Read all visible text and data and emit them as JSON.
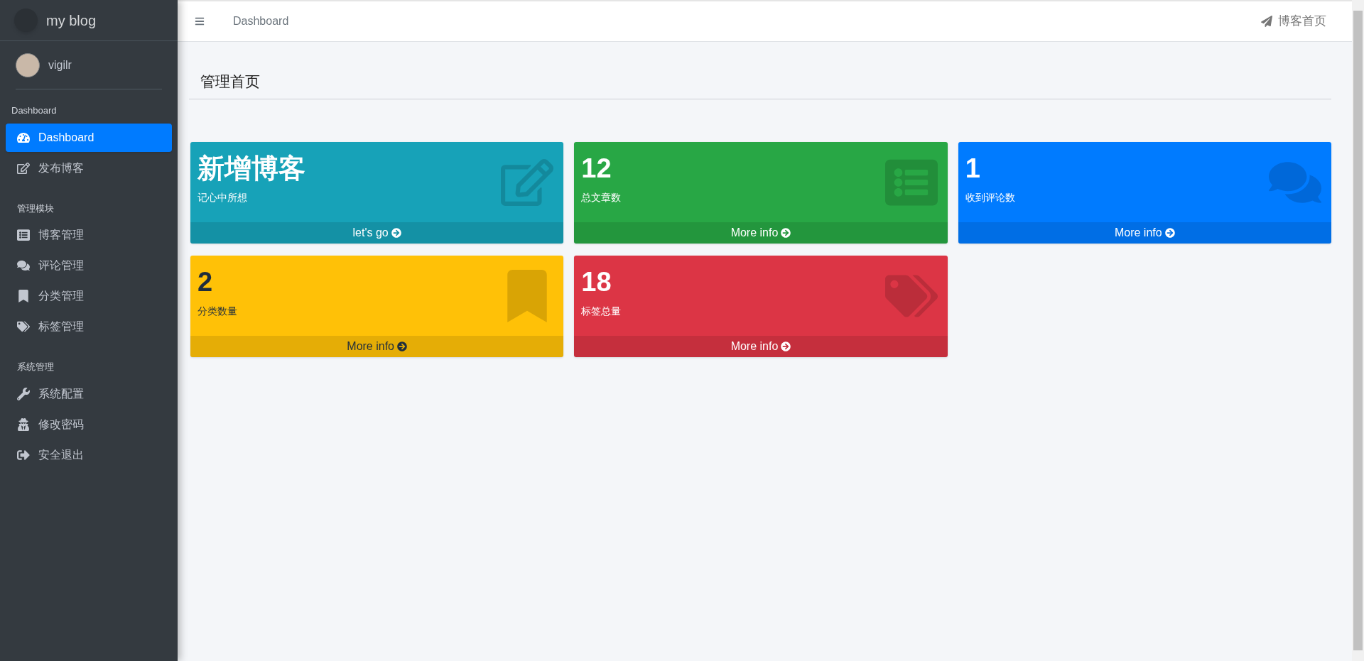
{
  "brand": {
    "title": "my blog"
  },
  "user": {
    "name": "vigilr"
  },
  "sidebar": {
    "sections": [
      {
        "heading": "Dashboard",
        "items": [
          {
            "kind": "dashboard",
            "label": "Dashboard",
            "selected": true
          },
          {
            "kind": "edit",
            "label": "发布博客",
            "selected": false
          }
        ]
      },
      {
        "heading": "管理模块",
        "items": [
          {
            "kind": "list",
            "label": "博客管理",
            "selected": false
          },
          {
            "kind": "comments",
            "label": "评论管理",
            "selected": false
          },
          {
            "kind": "bookmark",
            "label": "分类管理",
            "selected": false
          },
          {
            "kind": "tags",
            "label": "标签管理",
            "selected": false
          }
        ]
      },
      {
        "heading": "系统管理",
        "items": [
          {
            "kind": "wrench",
            "label": "系统配置",
            "selected": false
          },
          {
            "kind": "secret",
            "label": "修改密码",
            "selected": false
          },
          {
            "kind": "logout",
            "label": "安全退出",
            "selected": false
          }
        ]
      }
    ]
  },
  "topbar": {
    "breadcrumb": "Dashboard",
    "link": "博客首页"
  },
  "page": {
    "title": "管理首页"
  },
  "cards": [
    {
      "kind": "edit",
      "value": "新增博客",
      "label": "记心中所想",
      "footer": "let's go",
      "color": "#17a2b8"
    },
    {
      "kind": "list",
      "value": "12",
      "label": "总文章数",
      "footer": "More info",
      "color": "#28a745"
    },
    {
      "kind": "comments",
      "value": "1",
      "label": "收到评论数",
      "footer": "More info",
      "color": "#007bff"
    },
    {
      "kind": "bookmark",
      "value": "2",
      "label": "分类数量",
      "footer": "More info",
      "color": "#ffc107"
    },
    {
      "kind": "tags",
      "value": "18",
      "label": "标签总量",
      "footer": "More info",
      "color": "#dc3545"
    }
  ]
}
